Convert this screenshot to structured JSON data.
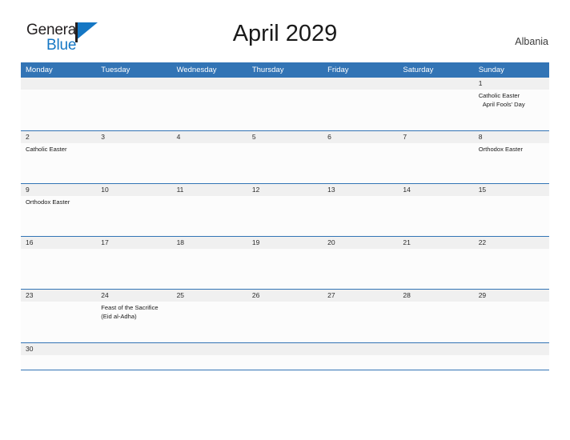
{
  "logo": {
    "word_one": "General",
    "word_two": "Blue",
    "flag_color": "#1577c4",
    "text_color": "#231f20"
  },
  "header": {
    "title": "April 2029",
    "region": "Albania"
  },
  "theme": {
    "accent": "#3274b5",
    "date_band": "#f0f0f0",
    "cell_bg": "#fcfcfc",
    "header_text": "#ffffff"
  },
  "calendar": {
    "weekdays": [
      "Monday",
      "Tuesday",
      "Wednesday",
      "Thursday",
      "Friday",
      "Saturday",
      "Sunday"
    ],
    "weeks": [
      {
        "days": [
          {
            "date": "",
            "events": []
          },
          {
            "date": "",
            "events": []
          },
          {
            "date": "",
            "events": []
          },
          {
            "date": "",
            "events": []
          },
          {
            "date": "",
            "events": []
          },
          {
            "date": "",
            "events": []
          },
          {
            "date": "1",
            "events": [
              "Catholic Easter",
              "April Fools' Day"
            ]
          }
        ]
      },
      {
        "days": [
          {
            "date": "2",
            "events": [
              "Catholic Easter"
            ]
          },
          {
            "date": "3",
            "events": []
          },
          {
            "date": "4",
            "events": []
          },
          {
            "date": "5",
            "events": []
          },
          {
            "date": "6",
            "events": []
          },
          {
            "date": "7",
            "events": []
          },
          {
            "date": "8",
            "events": [
              "Orthodox Easter"
            ]
          }
        ]
      },
      {
        "days": [
          {
            "date": "9",
            "events": [
              "Orthodox Easter"
            ]
          },
          {
            "date": "10",
            "events": []
          },
          {
            "date": "11",
            "events": []
          },
          {
            "date": "12",
            "events": []
          },
          {
            "date": "13",
            "events": []
          },
          {
            "date": "14",
            "events": []
          },
          {
            "date": "15",
            "events": []
          }
        ]
      },
      {
        "days": [
          {
            "date": "16",
            "events": []
          },
          {
            "date": "17",
            "events": []
          },
          {
            "date": "18",
            "events": []
          },
          {
            "date": "19",
            "events": []
          },
          {
            "date": "20",
            "events": []
          },
          {
            "date": "21",
            "events": []
          },
          {
            "date": "22",
            "events": []
          }
        ]
      },
      {
        "days": [
          {
            "date": "23",
            "events": []
          },
          {
            "date": "24",
            "events": [
              "Feast of the Sacrifice (Eid al-Adha)"
            ]
          },
          {
            "date": "25",
            "events": []
          },
          {
            "date": "26",
            "events": []
          },
          {
            "date": "27",
            "events": []
          },
          {
            "date": "28",
            "events": []
          },
          {
            "date": "29",
            "events": []
          }
        ]
      },
      {
        "days": [
          {
            "date": "30",
            "events": []
          },
          {
            "date": "",
            "events": []
          },
          {
            "date": "",
            "events": []
          },
          {
            "date": "",
            "events": []
          },
          {
            "date": "",
            "events": []
          },
          {
            "date": "",
            "events": []
          },
          {
            "date": "",
            "events": []
          }
        ]
      }
    ]
  }
}
